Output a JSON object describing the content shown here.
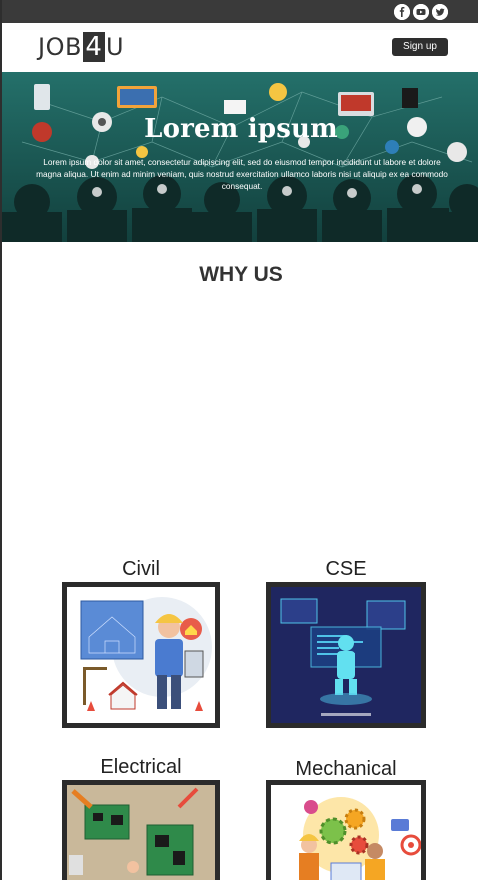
{
  "topbar": {
    "social_icons": [
      "facebook-icon",
      "youtube-icon",
      "twitter-icon"
    ]
  },
  "header": {
    "logo": {
      "part1": "JOB",
      "part2": "4",
      "part3": "U"
    },
    "signup_label": "Sign up"
  },
  "hero": {
    "title": "Lorem ipsum",
    "text": "Lorem ipsum dolor sit amet, consectetur adipiscing elit, sed do eiusmod tempor incididunt ut labore et dolore magna aliqua. Ut enim ad minim veniam, quis nostrud exercitation ullamco laboris nisi ut aliquip ex ea commodo consequat."
  },
  "why_us": {
    "heading": "WHY US"
  },
  "categories": [
    {
      "title": "Civil"
    },
    {
      "title": "CSE"
    },
    {
      "title": "Electrical"
    },
    {
      "title": "Mechanical"
    }
  ],
  "colors": {
    "dark": "#2e2e2e",
    "hero_bg": "#1d5a56",
    "cse_bg": "#1f2660"
  }
}
